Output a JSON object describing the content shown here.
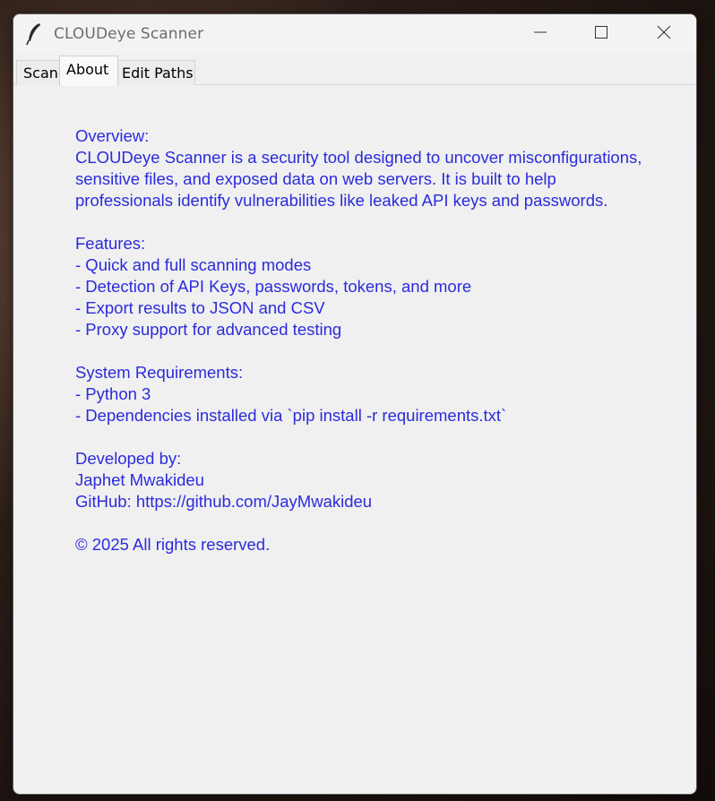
{
  "window": {
    "title": "CLOUDeye Scanner",
    "controls": {
      "minimize_icon": "minimize-icon",
      "maximize_icon": "maximize-icon",
      "close_icon": "close-icon"
    }
  },
  "tabs": [
    {
      "label": "Scan",
      "selected": false
    },
    {
      "label": "About",
      "selected": true
    },
    {
      "label": "Edit Paths",
      "selected": false
    }
  ],
  "about": {
    "overview_heading": "Overview:",
    "overview_lines": [
      "CLOUDeye Scanner is a security tool designed to uncover misconfigurations,",
      "sensitive files, and exposed data on web servers. It is built to help",
      "professionals identify vulnerabilities like leaked API keys and passwords."
    ],
    "features_heading": "Features:",
    "features": [
      "- Quick and full scanning modes",
      "- Detection of API Keys, passwords, tokens, and more",
      "- Export results to JSON and CSV",
      "- Proxy support for advanced testing"
    ],
    "requirements_heading": "System Requirements:",
    "requirements": [
      "- Python 3",
      "- Dependencies installed via `pip install -r requirements.txt`"
    ],
    "developer_heading": "Developed by:",
    "developer_name": "Japhet Mwakideu",
    "github": "GitHub: https://github.com/JayMwakideu",
    "copyright": "© 2025 All rights reserved."
  },
  "colors": {
    "text_accent": "#2b2bdc",
    "window_bg": "#f0f0f0"
  }
}
